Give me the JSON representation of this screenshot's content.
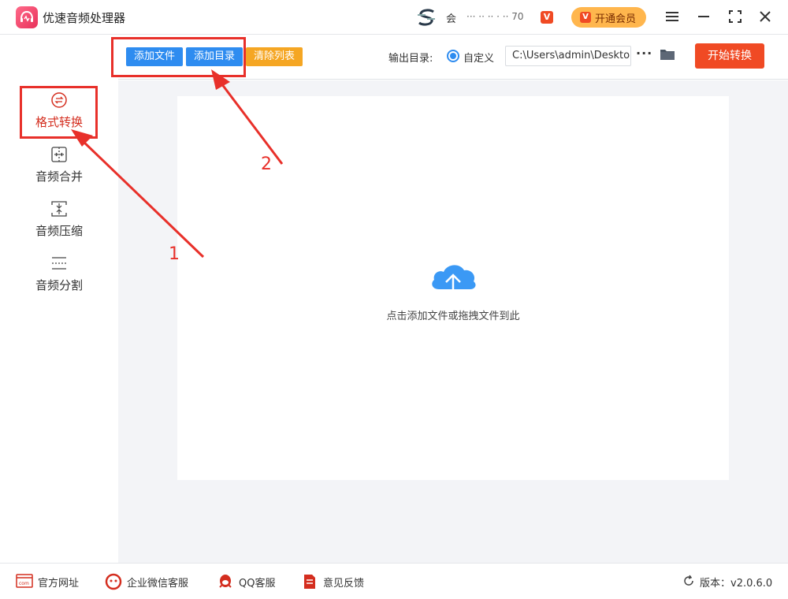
{
  "app": {
    "title": "优速音频处理器",
    "user_name": "会",
    "user_id": "··· ·· ·· · ·· 70",
    "vip_badge": "V",
    "vip_button_label": "开通会员"
  },
  "toolbar": {
    "add_file_label": "添加文件",
    "add_dir_label": "添加目录",
    "clear_list_label": "清除列表",
    "output_dir_label": "输出目录:",
    "custom_option_label": "自定义",
    "output_path_value": "C:\\Users\\admin\\Desktop",
    "more_label": "···",
    "start_label": "开始转换"
  },
  "sidebar": {
    "items": [
      {
        "label": "格式转换",
        "icon": "convert-icon",
        "active": true
      },
      {
        "label": "音频合并",
        "icon": "merge-icon",
        "active": false
      },
      {
        "label": "音频压缩",
        "icon": "compress-icon",
        "active": false
      },
      {
        "label": "音频分割",
        "icon": "split-icon",
        "active": false
      }
    ]
  },
  "main": {
    "drop_hint": "点击添加文件或拖拽文件到此"
  },
  "footer": {
    "website_label": "官方网址",
    "wechat_label": "企业微信客服",
    "qq_label": "QQ客服",
    "feedback_label": "意见反馈",
    "version_label": "版本：v2.0.6.0"
  },
  "annotations": {
    "step1": "1",
    "step2": "2"
  },
  "colors": {
    "accent_blue": "#2e8cf0",
    "accent_orange": "#f5a623",
    "start_red": "#f04a24",
    "annotation_red": "#e8302a"
  }
}
